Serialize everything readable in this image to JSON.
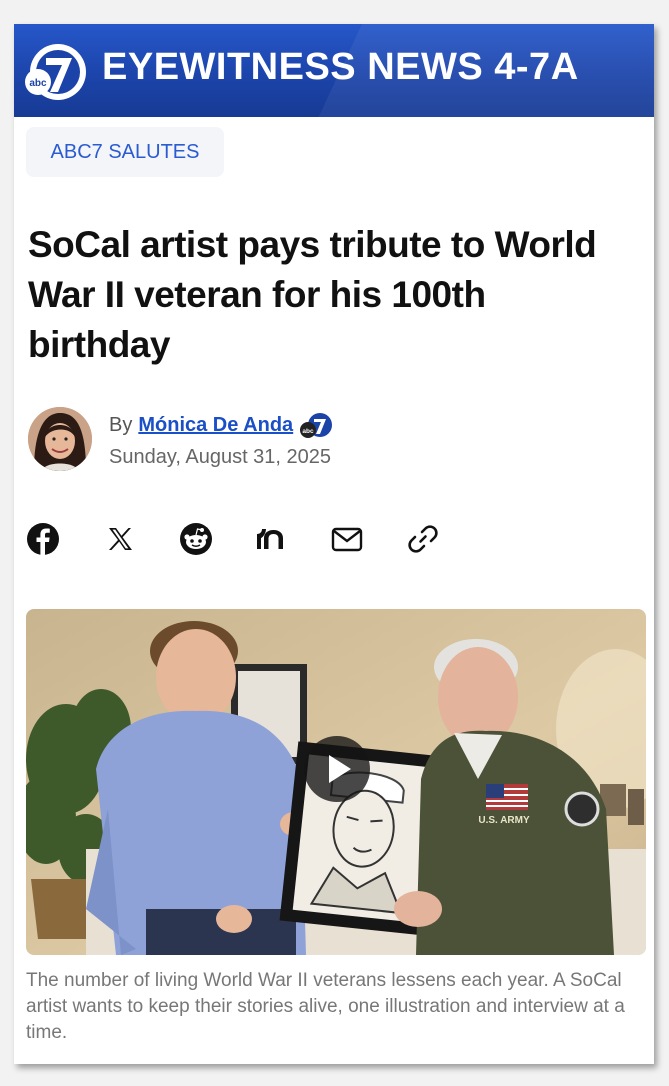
{
  "banner": {
    "logo_text": "abc",
    "logo_number": "7",
    "title": "EYEWITNESS NEWS 4-7A"
  },
  "article": {
    "category": "ABC7 SALUTES",
    "headline": "SoCal artist pays tribute to World War II veteran for his 100th birthday",
    "byline_prefix": "By",
    "author": "Mónica De Anda",
    "date": "Sunday, August 31, 2025",
    "caption": "The number of living World War II veterans lessens each year. A SoCal artist wants to keep their stories alive, one illustration and interview at a time."
  },
  "share_icons": [
    "facebook-icon",
    "x-icon",
    "reddit-icon",
    "nextdoor-icon",
    "email-icon",
    "copy-link-icon"
  ],
  "colors": {
    "banner": "#1b43a8",
    "link": "#1a4fc8",
    "tag_text": "#2a5bd0"
  },
  "media": {
    "type": "video",
    "patch_text": "U.S. ARMY"
  }
}
